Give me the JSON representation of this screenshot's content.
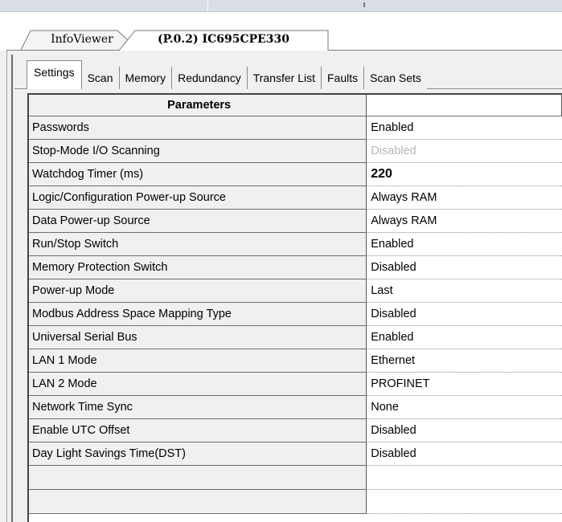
{
  "document_tabs": [
    {
      "label": "InfoViewer",
      "active": false
    },
    {
      "label": "(P.0.2) IC695CPE330",
      "active": true
    }
  ],
  "property_tabs": [
    {
      "label": "Settings",
      "active": true
    },
    {
      "label": "Scan"
    },
    {
      "label": "Memory"
    },
    {
      "label": "Redundancy"
    },
    {
      "label": "Transfer List"
    },
    {
      "label": "Faults"
    },
    {
      "label": "Scan Sets"
    }
  ],
  "grid": {
    "header": "Parameters",
    "rows": [
      {
        "name": "Passwords",
        "value": "Enabled"
      },
      {
        "name": "Stop-Mode I/O Scanning",
        "value": "Disabled"
      },
      {
        "name": "Watchdog Timer (ms)",
        "value": "220"
      },
      {
        "name": "Logic/Configuration Power-up Source",
        "value": "Always RAM"
      },
      {
        "name": "Data Power-up Source",
        "value": "Always RAM"
      },
      {
        "name": "Run/Stop Switch",
        "value": "Enabled"
      },
      {
        "name": "Memory Protection Switch",
        "value": "Disabled"
      },
      {
        "name": "Power-up Mode",
        "value": "Last"
      },
      {
        "name": "Modbus Address Space Mapping Type",
        "value": "Disabled"
      },
      {
        "name": "Universal Serial Bus",
        "value": "Enabled"
      },
      {
        "name": "LAN 1 Mode",
        "value": "Ethernet"
      },
      {
        "name": "LAN 2 Mode",
        "value": "PROFINET"
      },
      {
        "name": "Network Time Sync",
        "value": "None"
      },
      {
        "name": "Enable UTC Offset",
        "value": "Disabled"
      },
      {
        "name": "Day Light Savings Time(DST)",
        "value": "Disabled"
      }
    ]
  },
  "colors": {
    "grayed_value": "#b8b8b8",
    "grid_bg": "#ffffff",
    "name_column_bg": "#f0f0f0"
  }
}
